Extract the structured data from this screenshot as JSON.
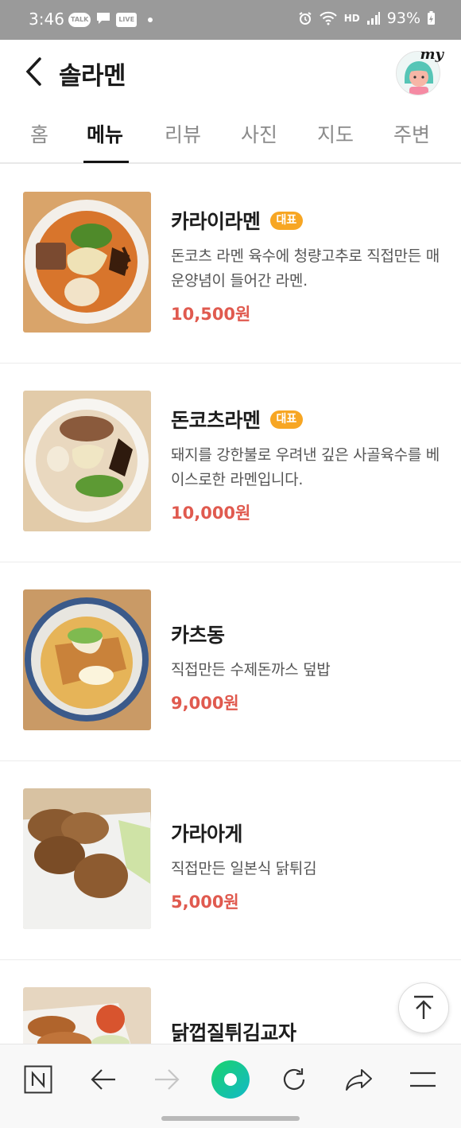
{
  "status_bar": {
    "time": "3:46",
    "icons_left": [
      "TALK",
      "chat",
      "LIVE"
    ],
    "icons_right": [
      "alarm-icon",
      "wifi-icon",
      "hd-voice-icon",
      "signal-icon"
    ],
    "hd_label": "HD",
    "battery_percent": "93%"
  },
  "header": {
    "title": "솔라멘",
    "my_label": "my"
  },
  "tabs": [
    {
      "label": "홈"
    },
    {
      "label": "메뉴",
      "active": true
    },
    {
      "label": "리뷰"
    },
    {
      "label": "사진"
    },
    {
      "label": "지도"
    },
    {
      "label": "주변"
    }
  ],
  "menu": {
    "items": [
      {
        "name": "카라이라멘",
        "badge": "대표",
        "desc": "돈코츠 라멘 육수에 청량고추로 직접만든 매운양념이 들어간 라멘.",
        "price": "10,500원"
      },
      {
        "name": "돈코츠라멘",
        "badge": "대표",
        "desc": "돼지를 강한불로 우려낸 깊은 사골육수를 베이스로한 라멘입니다.",
        "price": "10,000원"
      },
      {
        "name": "카츠동",
        "badge": "",
        "desc": "직접만든 수제돈까스 덮밥",
        "price": "9,000원"
      },
      {
        "name": "가라아게",
        "badge": "",
        "desc": "직접만든 일본식 닭튀김",
        "price": "5,000원"
      },
      {
        "name": "닭껍질튀김교자",
        "badge": "",
        "desc": "",
        "price": ""
      }
    ]
  },
  "bottom_bar": {
    "buttons": [
      "naver-n-icon",
      "back-arrow-icon",
      "forward-arrow-icon",
      "green-dot-icon",
      "refresh-icon",
      "share-icon",
      "menu-icon"
    ]
  },
  "colors": {
    "price": "#e05a4f",
    "badge": "#f7a623",
    "status_bar": "#9a9a9a",
    "green_button": "#19ce60"
  }
}
